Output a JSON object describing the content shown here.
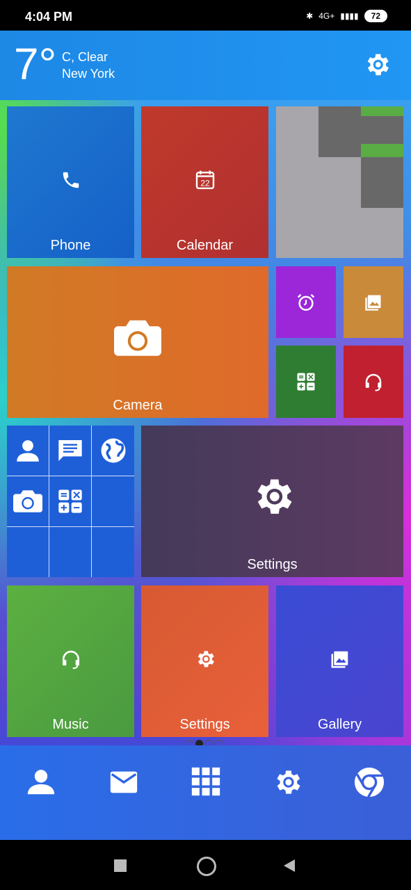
{
  "status": {
    "time": "4:04 PM",
    "network": "4G+",
    "battery": "72"
  },
  "weather": {
    "temp": "7°",
    "condition": "C, Clear",
    "city": "New York"
  },
  "tiles": {
    "phone": "Phone",
    "calendar": "Calendar",
    "calendar_day": "22",
    "camera": "Camera",
    "settings_large": "Settings",
    "music": "Music",
    "settings_small": "Settings",
    "gallery": "Gallery"
  },
  "colors": {
    "phone": "#1e7ad4",
    "calendar": "#c0392b",
    "camera": "#d9772a",
    "settings_large": "#4a3a60",
    "music": "#5ca845",
    "settings_small": "#e5603a",
    "gallery": "#3f4fd4"
  },
  "icons": [
    "phone-icon",
    "calendar-icon",
    "camera-icon",
    "alarm-icon",
    "image-icon",
    "calculator-icon",
    "headset-icon",
    "contacts-icon",
    "message-icon",
    "globe-icon",
    "gear-icon",
    "mail-icon",
    "apps-grid-icon",
    "chrome-icon"
  ]
}
